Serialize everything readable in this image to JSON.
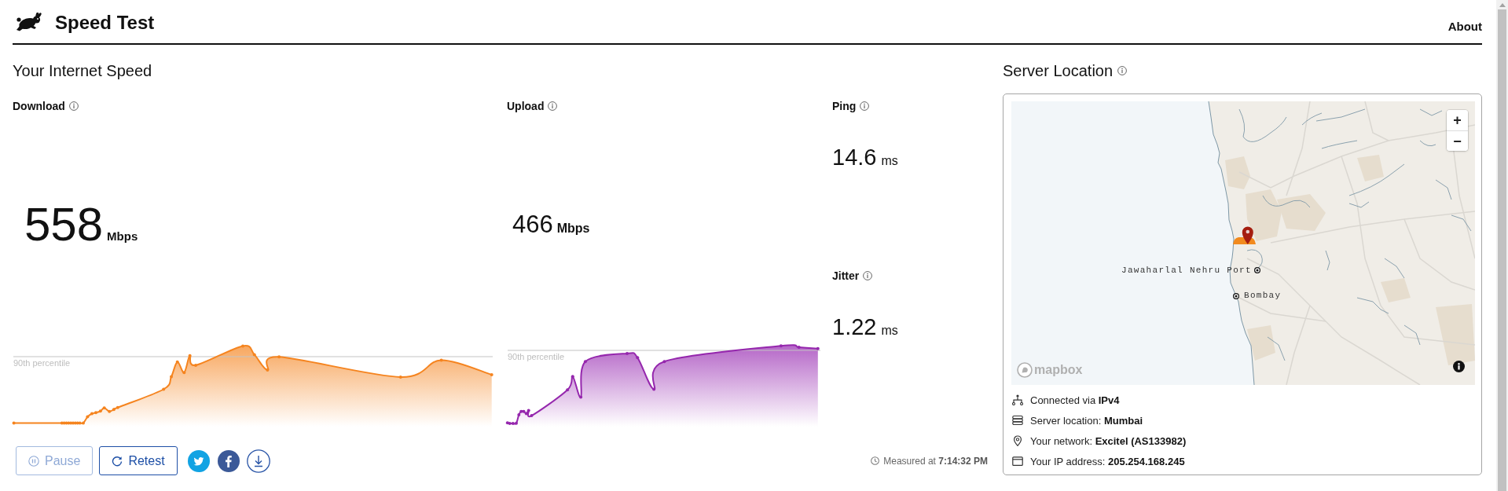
{
  "header": {
    "title": "Speed Test",
    "nav": [
      {
        "label": "About"
      }
    ]
  },
  "speed": {
    "title": "Your Internet Speed",
    "download": {
      "label": "Download",
      "value": "558",
      "unit": "Mbps",
      "graph": {
        "reference_label": "90th percentile"
      }
    },
    "upload": {
      "label": "Upload",
      "value": "466",
      "unit": "Mbps",
      "graph": {
        "reference_label": "90th percentile"
      }
    },
    "latency": [
      {
        "label": "Ping",
        "value": "14.6",
        "unit": "ms"
      },
      {
        "label": "Jitter",
        "value": "1.22",
        "unit": "ms"
      }
    ],
    "buttons": [
      {
        "label": "Pause",
        "disabled": true
      },
      {
        "label": "Retest",
        "disabled": false
      }
    ],
    "measured_at": "Measured at **7:14:32 PM**"
  },
  "server": {
    "title": "Server Location",
    "map": {
      "places": [
        "Jawaharlal Nehru Port",
        "Bombay"
      ],
      "zoom_controls": [
        "+",
        "−"
      ],
      "logo": "mapbox"
    },
    "details": [
      "Connected via **IPv4**",
      "Server location: **Mumbai**",
      "Your network: **Excitel (AS133982)**",
      "Your IP address: **205.254.168.245**"
    ]
  }
}
